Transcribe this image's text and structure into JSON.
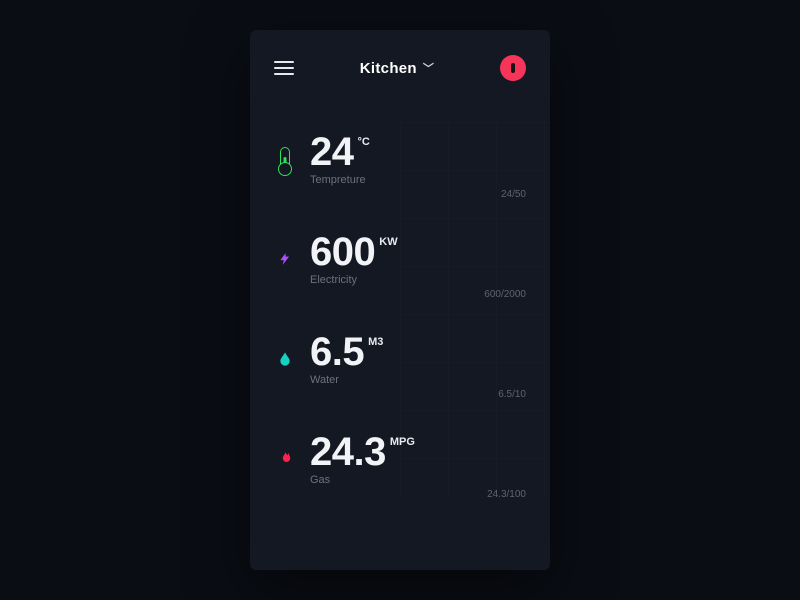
{
  "header": {
    "room": "Kitchen"
  },
  "metrics": [
    {
      "id": "temperature",
      "icon": "thermometer",
      "value": "24",
      "unit": "°C",
      "label": "Tempreture",
      "ratio": "24/50"
    },
    {
      "id": "electricity",
      "icon": "bolt",
      "value": "600",
      "unit": "KW",
      "label": "Electricity",
      "ratio": "600/2000"
    },
    {
      "id": "water",
      "icon": "drop",
      "value": "6.5",
      "unit": "M3",
      "label": "Water",
      "ratio": "6.5/10"
    },
    {
      "id": "gas",
      "icon": "flame",
      "value": "24.3",
      "unit": "MPG",
      "label": "Gas",
      "ratio": "24.3/100"
    }
  ]
}
